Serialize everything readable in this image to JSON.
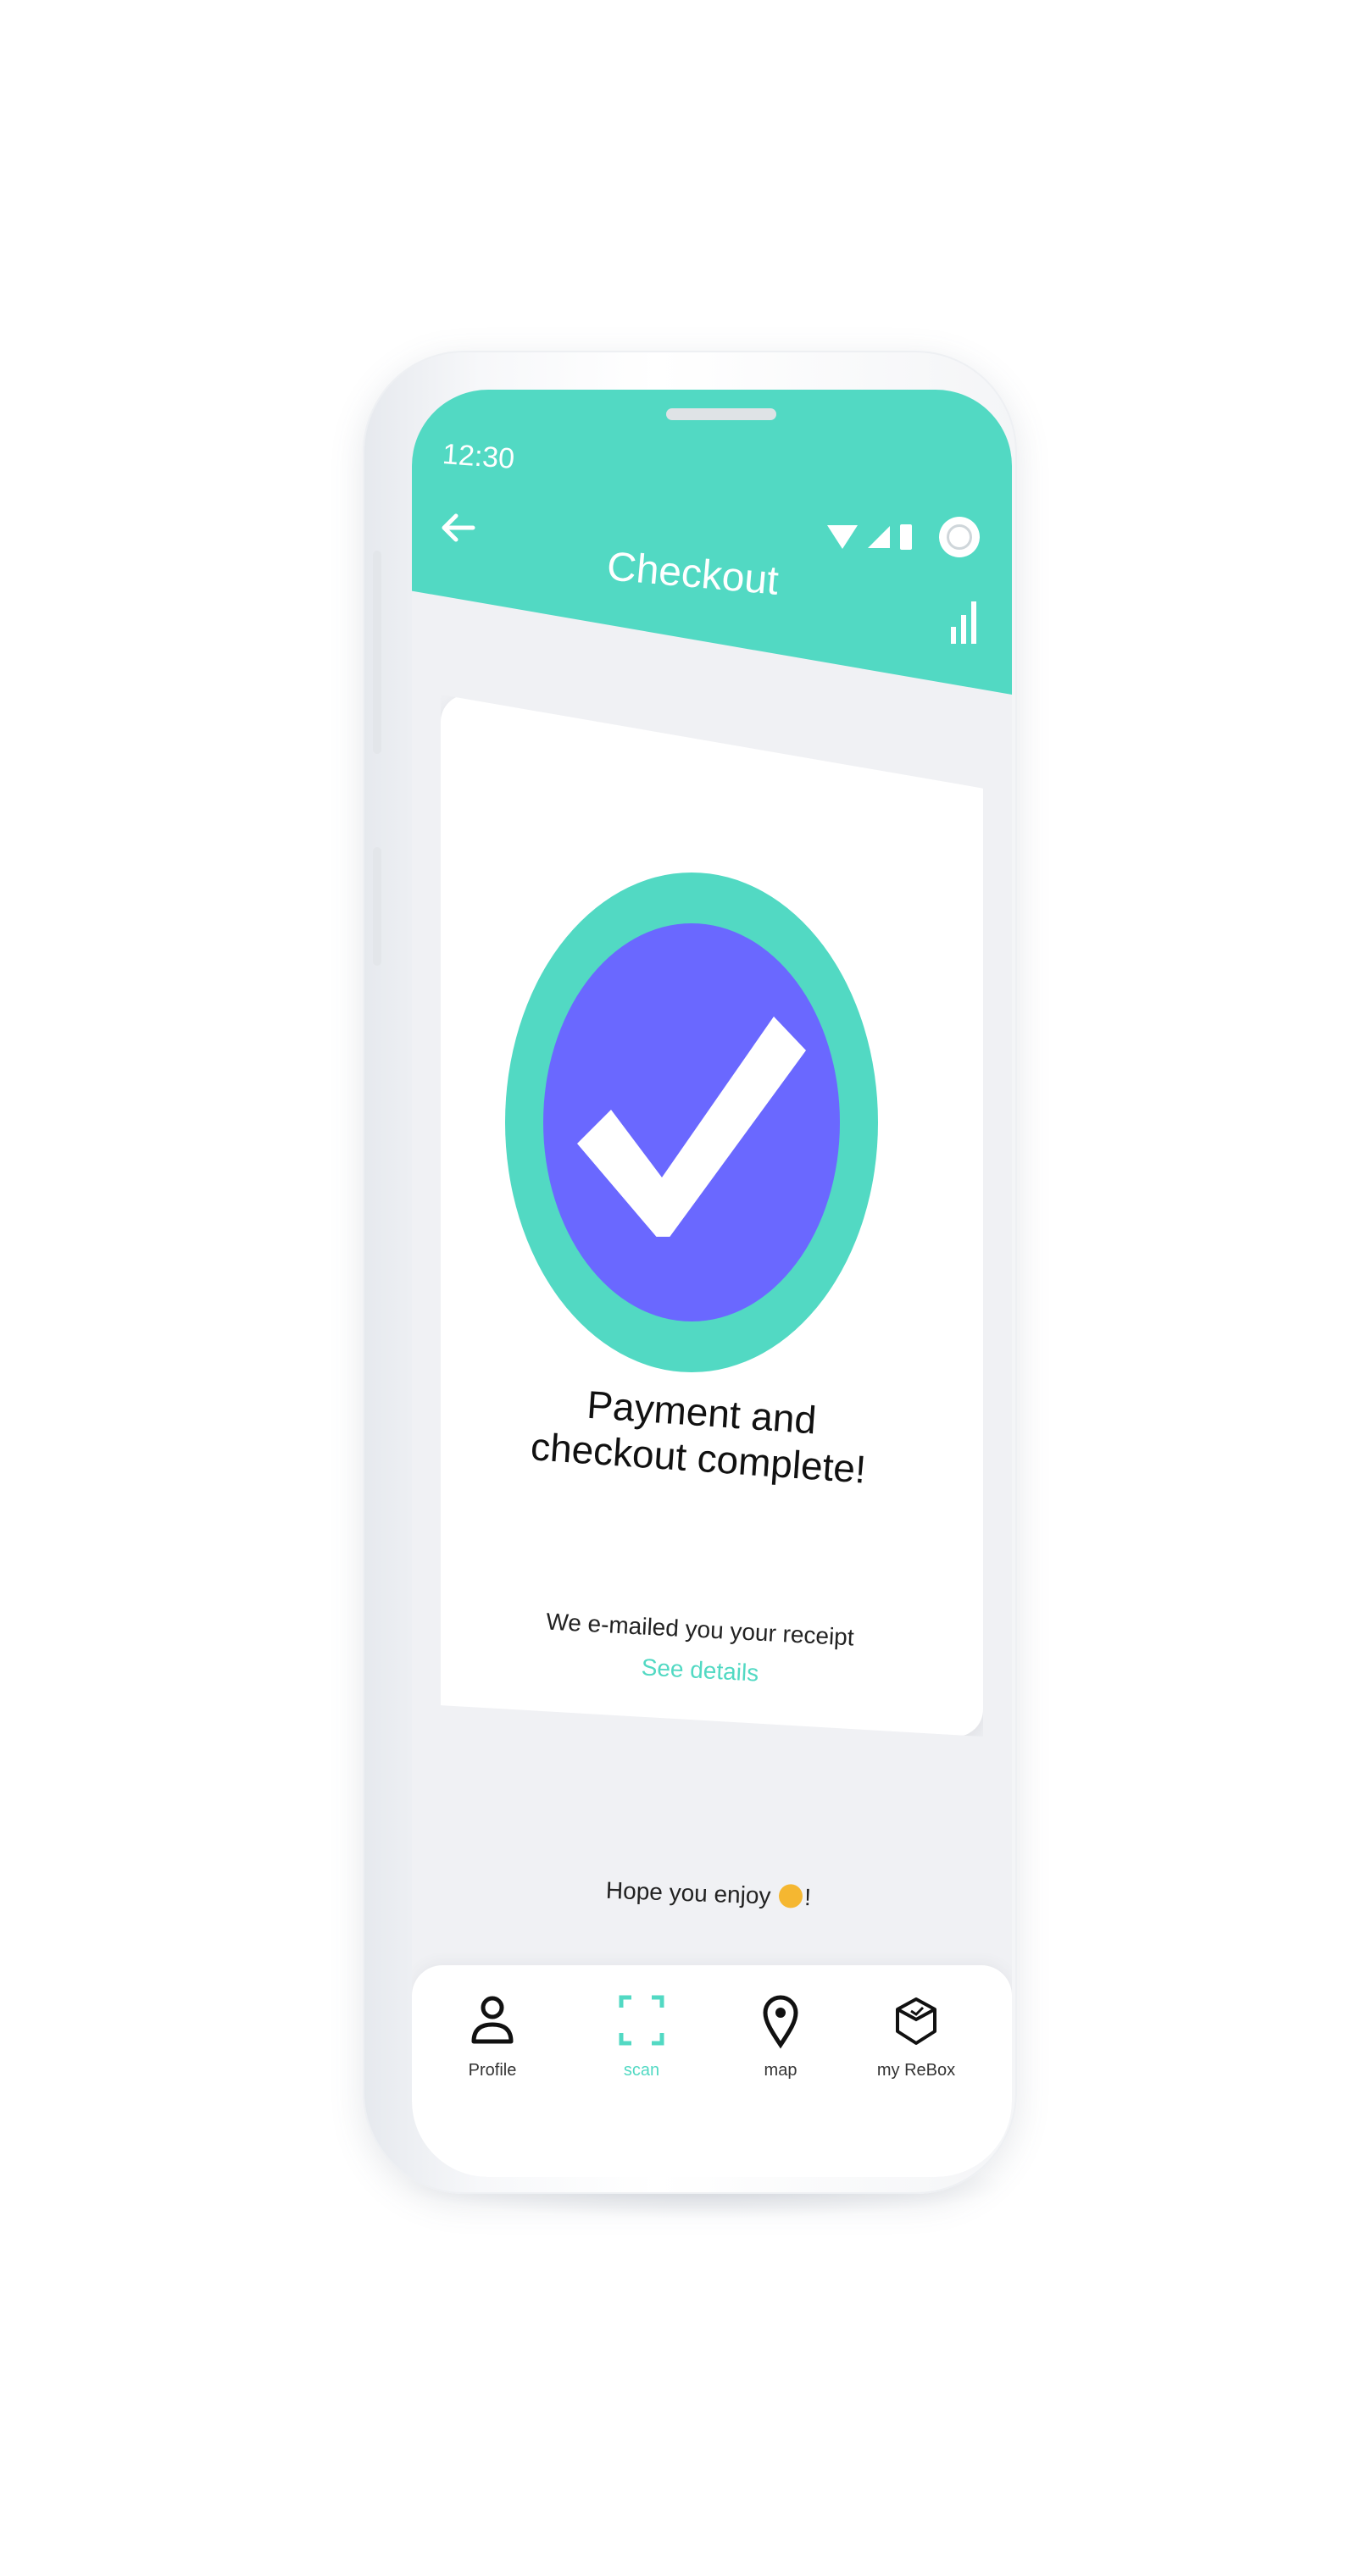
{
  "status_bar": {
    "time": "12:30"
  },
  "header": {
    "title": "Checkout",
    "back_icon": "arrow-left-icon",
    "stats_icon": "bar-chart-icon"
  },
  "card": {
    "badge_icon": "check-circle-icon",
    "title": "Payment and checkout complete!",
    "receipt_text": "We e-mailed you your receipt",
    "details_link": "See details"
  },
  "footer_message": {
    "text_before": "Hope you enjoy",
    "text_after": "!",
    "emoji_icon": "smiling-face-icon"
  },
  "bottom_nav": {
    "items": [
      {
        "label": "Profile",
        "icon": "person-icon",
        "active": false
      },
      {
        "label": "scan",
        "icon": "scan-icon",
        "active": true
      },
      {
        "label": "map",
        "icon": "location-pin-icon",
        "active": false
      },
      {
        "label": "my ReBox",
        "icon": "box-icon",
        "active": false
      }
    ]
  },
  "colors": {
    "accent": "#52d9c3",
    "badge_inner": "#6a68ff",
    "background": "#f0f1f4"
  }
}
